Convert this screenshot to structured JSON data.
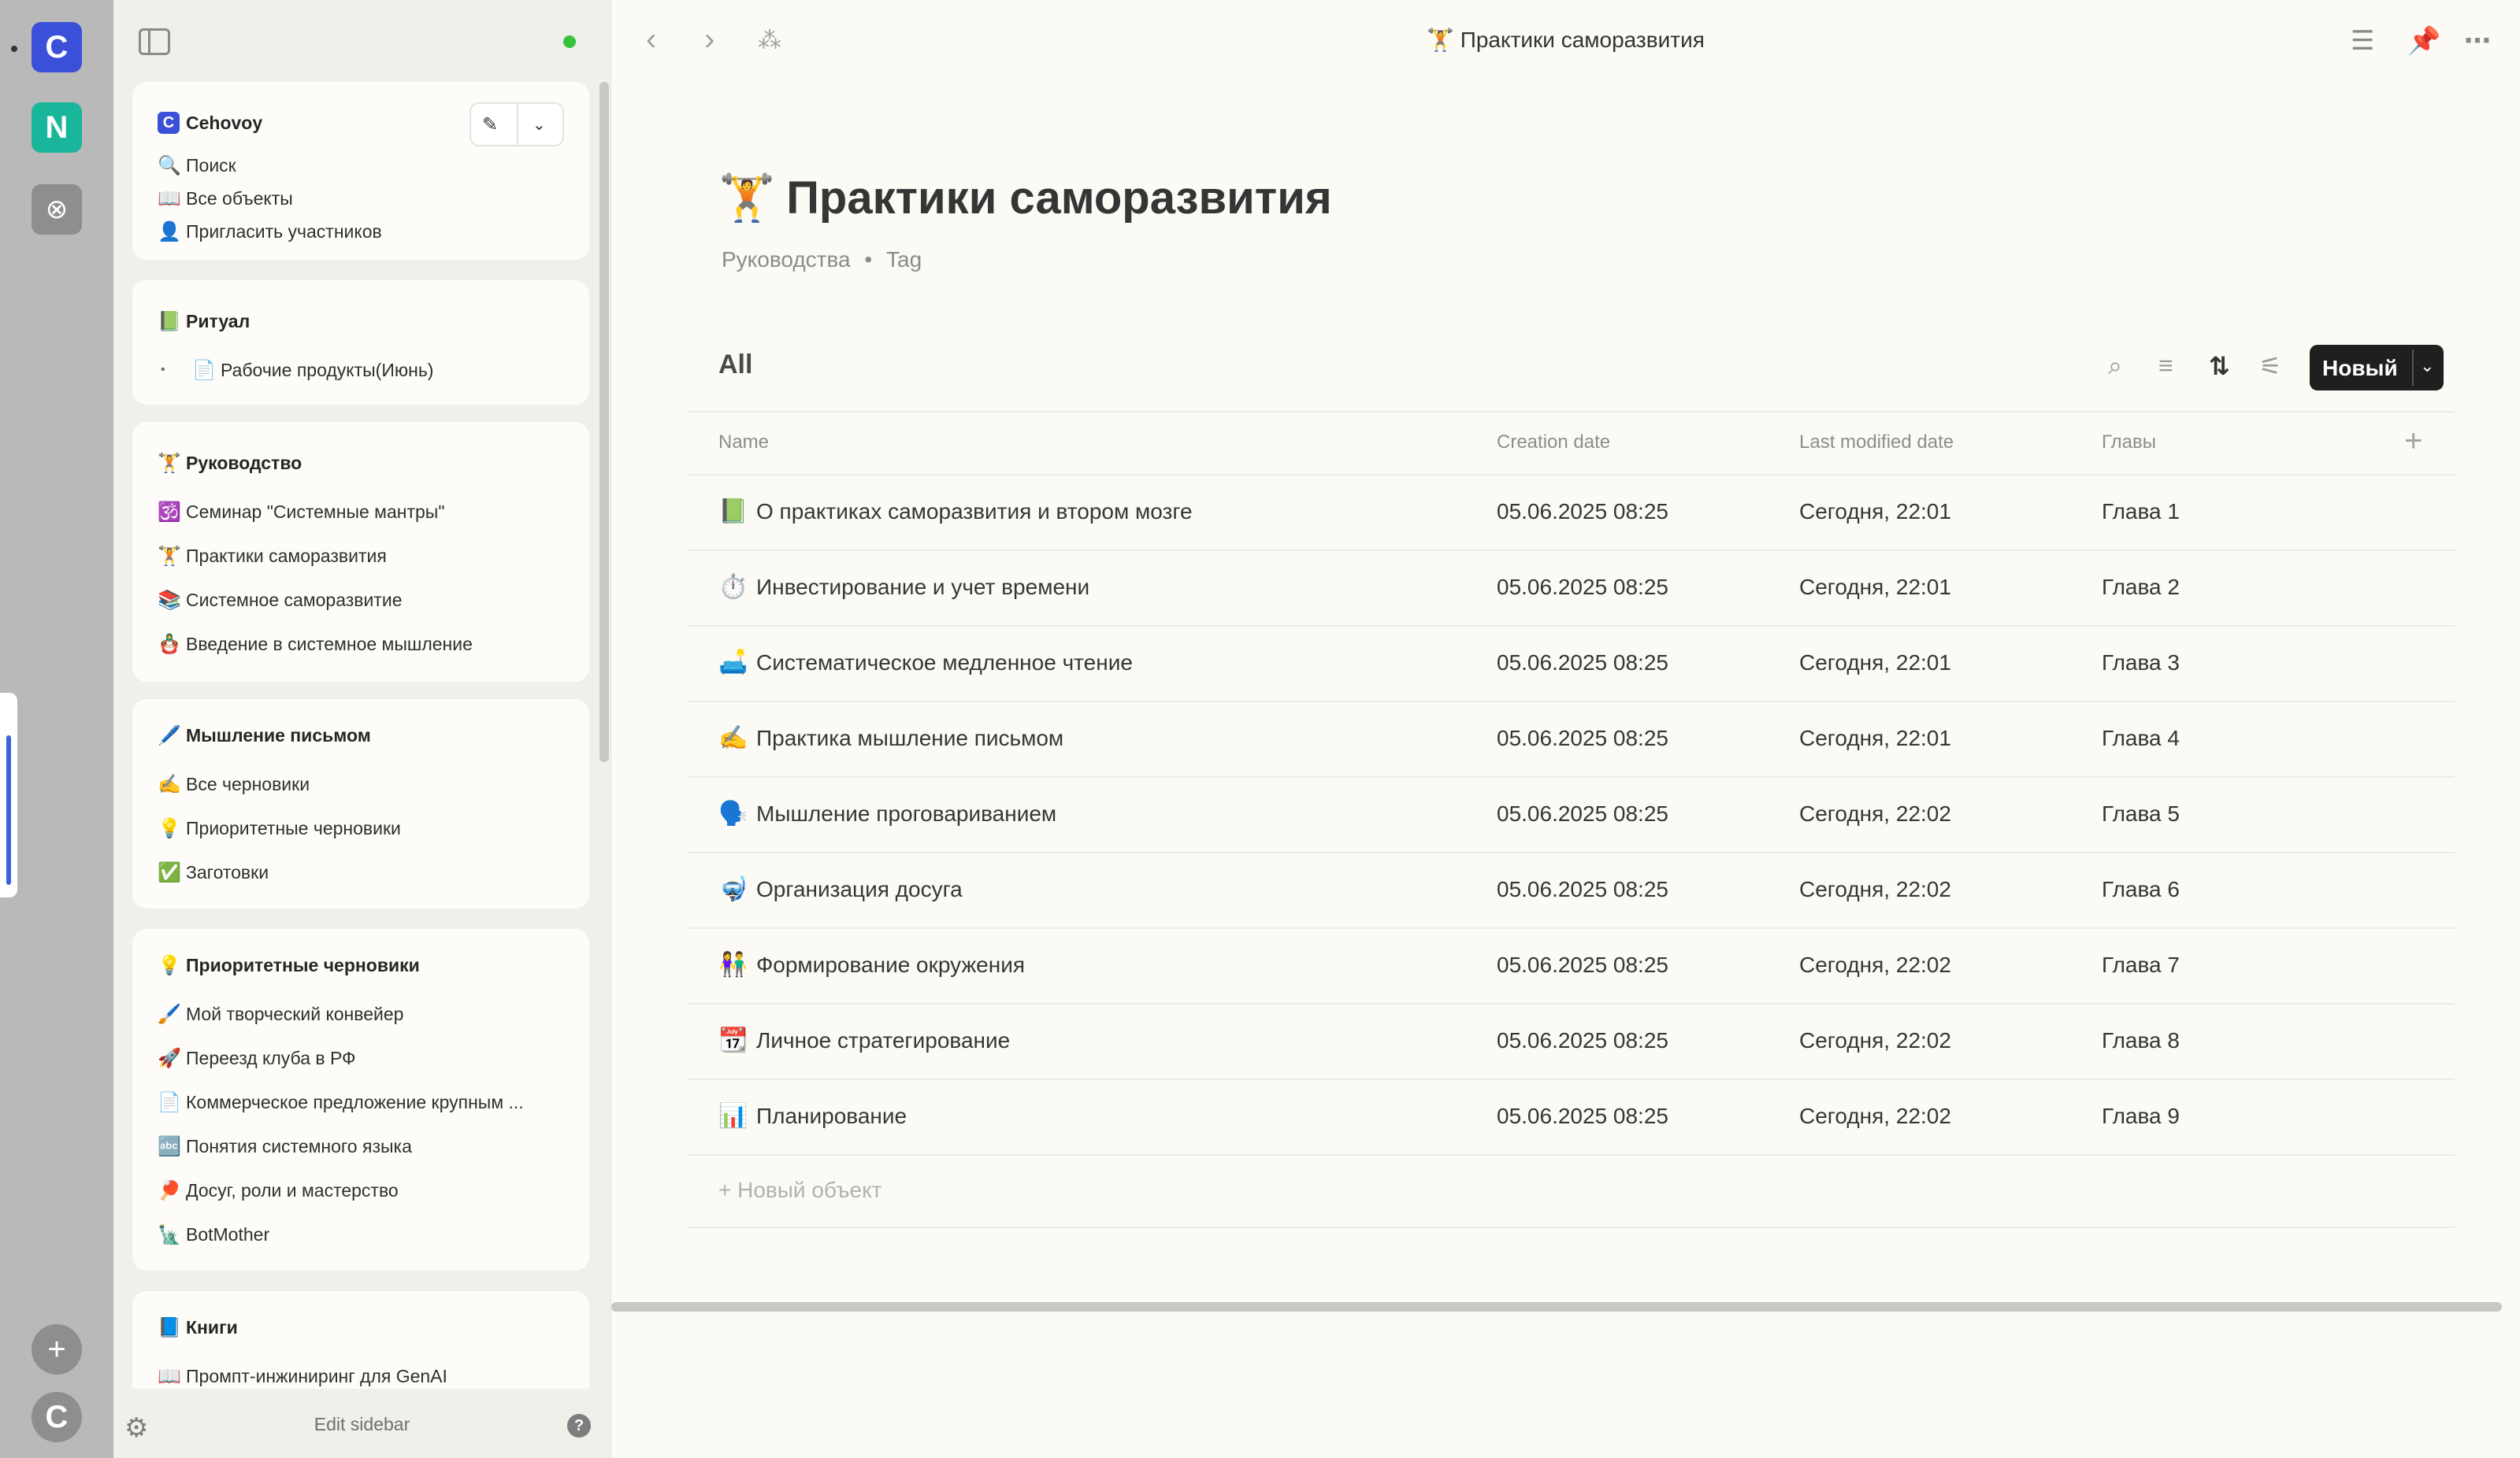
{
  "rail": {
    "spaces": [
      {
        "letter": "C",
        "color": "#3b50d9"
      },
      {
        "letter": "N",
        "color": "#19b69b"
      }
    ],
    "third_icon": "basketball-icon",
    "add": "+",
    "profile": "C"
  },
  "sidebar": {
    "workspace": {
      "name": "Cehovoy",
      "badge": "C",
      "items": [
        {
          "icon": "🔍",
          "label": "Поиск"
        },
        {
          "icon": "📖",
          "label": "Все объекты"
        },
        {
          "icon": "👤",
          "label": "Пригласить участников"
        }
      ]
    },
    "sections": [
      {
        "icon": "📗",
        "title": "Ритуал",
        "items": [
          {
            "icon": "📄",
            "label": "Рабочие продукты(Июнь)"
          }
        ]
      },
      {
        "icon": "🏋️",
        "title": "Руководство",
        "items": [
          {
            "icon": "🕉️",
            "label": "Семинар \"Системные мантры\""
          },
          {
            "icon": "🏋️",
            "label": "Практики саморазвития"
          },
          {
            "icon": "📚",
            "label": "Системное саморазвитие"
          },
          {
            "icon": "🪆",
            "label": "Введение в системное мышление"
          }
        ]
      },
      {
        "icon": "🖊️",
        "title": "Мышление письмом",
        "items": [
          {
            "icon": "✍️",
            "label": "Все черновики"
          },
          {
            "icon": "💡",
            "label": "Приоритетные черновики"
          },
          {
            "icon": "✅",
            "label": "Заготовки"
          }
        ]
      },
      {
        "icon": "💡",
        "title": "Приоритетные черновики",
        "items": [
          {
            "icon": "🖌️",
            "label": "Мой творческий конвейер"
          },
          {
            "icon": "🚀",
            "label": "Переезд клуба в РФ"
          },
          {
            "icon": "📄",
            "label": "Коммерческое предложение крупным ..."
          },
          {
            "icon": "🔤",
            "label": "Понятия системного языка"
          },
          {
            "icon": "🏓",
            "label": "Досуг, роли и мастерство"
          },
          {
            "icon": "🗽",
            "label": "BotMother"
          }
        ]
      },
      {
        "icon": "📘",
        "title": "Книги",
        "items": [
          {
            "icon": "📖",
            "label": "Промпт-инжиниринг для GenAI"
          }
        ]
      }
    ],
    "footer": {
      "edit_label": "Edit sidebar",
      "help": "?"
    }
  },
  "topbar": {
    "title_emoji": "🏋️",
    "title": "Практики саморазвития"
  },
  "page": {
    "emoji": "🏋️",
    "title": "Практики саморазвития",
    "meta_type": "Руководства",
    "meta_sep": "•",
    "meta_tag": "Tag",
    "view_name": "All",
    "new_button": "Новый"
  },
  "table": {
    "columns": [
      "Name",
      "Creation date",
      "Last modified date",
      "Главы"
    ],
    "rows": [
      {
        "emoji": "📗",
        "name": "О практиках саморазвития и втором мозге",
        "created": "05.06.2025 08:25",
        "modified": "Сегодня, 22:01",
        "chapter": "Глава 1"
      },
      {
        "emoji": "⏱️",
        "name": "Инвестирование и учет времени",
        "created": "05.06.2025 08:25",
        "modified": "Сегодня, 22:01",
        "chapter": "Глава 2"
      },
      {
        "emoji": "🛋️",
        "name": "Систематическое медленное чтение",
        "created": "05.06.2025 08:25",
        "modified": "Сегодня, 22:01",
        "chapter": "Глава 3"
      },
      {
        "emoji": "✍️",
        "name": "Практика мышление письмом",
        "created": "05.06.2025 08:25",
        "modified": "Сегодня, 22:01",
        "chapter": "Глава 4"
      },
      {
        "emoji": "🗣️",
        "name": "Мышление проговариванием",
        "created": "05.06.2025 08:25",
        "modified": "Сегодня, 22:02",
        "chapter": "Глава 5"
      },
      {
        "emoji": "🤿",
        "name": "Организация досуга",
        "created": "05.06.2025 08:25",
        "modified": "Сегодня, 22:02",
        "chapter": "Глава 6"
      },
      {
        "emoji": "👫",
        "name": "Формирование окружения",
        "created": "05.06.2025 08:25",
        "modified": "Сегодня, 22:02",
        "chapter": "Глава 7"
      },
      {
        "emoji": "📆",
        "name": "Личное стратегирование",
        "created": "05.06.2025 08:25",
        "modified": "Сегодня, 22:02",
        "chapter": "Глава 8"
      },
      {
        "emoji": "📊",
        "name": "Планирование",
        "created": "05.06.2025 08:25",
        "modified": "Сегодня, 22:02",
        "chapter": "Глава 9"
      }
    ],
    "new_object": "Новый объект"
  }
}
